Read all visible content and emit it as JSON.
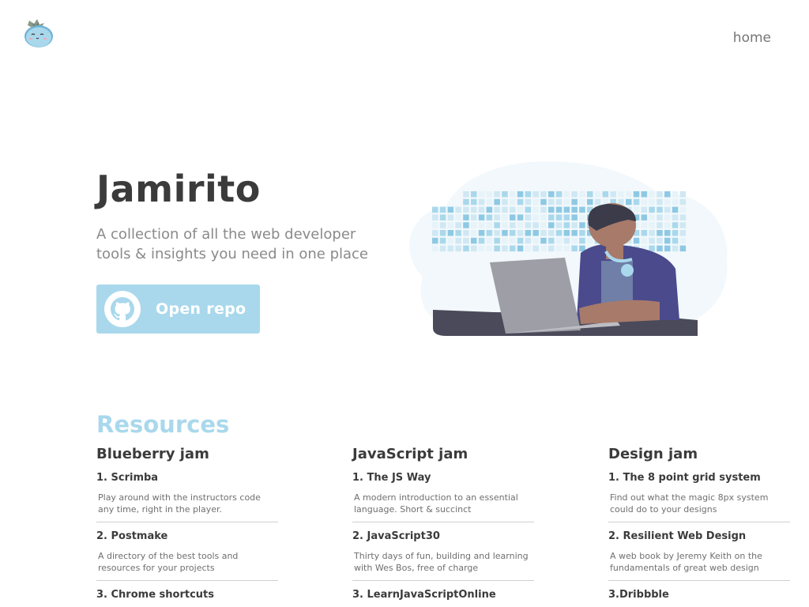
{
  "nav": {
    "home_label": "home"
  },
  "hero": {
    "title": "Jamirito",
    "subtitle": "A collection of all the web developer tools & insights you need in one place",
    "button_label": "Open repo"
  },
  "resources": {
    "title": "Resources",
    "columns": [
      {
        "title": "Blueberry jam",
        "items": [
          {
            "title": "1. Scrimba",
            "desc": "Play around with the instructors code any time, right in the player."
          },
          {
            "title": "2. Postmake",
            "desc": "A directory of the best tools and resources for your projects"
          },
          {
            "title": "3. Chrome shortcuts"
          }
        ]
      },
      {
        "title": "JavaScript jam",
        "items": [
          {
            "title": "1. The JS Way",
            "desc": "A modern introduction to an essential language. Short & succinct"
          },
          {
            "title": "2. JavaScript30",
            "desc": "Thirty days of fun, building and learning with Wes Bos, free of charge"
          },
          {
            "title": "3. LearnJavaScriptOnline"
          }
        ]
      },
      {
        "title": "Design jam",
        "items": [
          {
            "title": "1. The 8 point grid system",
            "desc": " Find out what the magic 8px system could do to your designs"
          },
          {
            "title": "2. Resilient Web Design",
            "desc": "A web book by Jeremy Keith on the fundamentals of great web design"
          },
          {
            "title": "3.Dribbble"
          }
        ]
      }
    ]
  },
  "colors": {
    "accent": "#a9d8ec",
    "heading": "#3b3b3b",
    "muted": "#8a8a8a"
  },
  "icons": {
    "logo": "blueberry-logo-icon",
    "button": "github-icon"
  }
}
